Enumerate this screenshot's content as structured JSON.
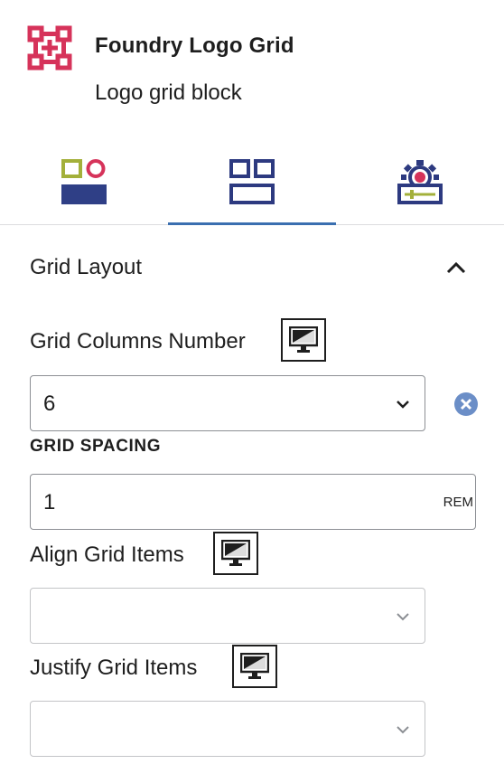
{
  "block": {
    "title": "Foundry Logo Grid",
    "description": "Logo grid block",
    "icon": "logo-grid-icon",
    "icon_color": "#d6335a"
  },
  "tabs": [
    {
      "name": "style",
      "icon": "shapes-style-icon",
      "active": false
    },
    {
      "name": "layout",
      "icon": "layout-blocks-icon",
      "active": true
    },
    {
      "name": "advanced",
      "icon": "gear-settings-icon",
      "active": false
    }
  ],
  "accent_color": "#3a6fb0",
  "panel": {
    "title": "Grid Layout",
    "expanded": true,
    "columns": {
      "label": "Grid Columns Number",
      "value": "6",
      "device_icon": "desktop-icon"
    },
    "spacing": {
      "label": "GRID SPACING",
      "value": "1",
      "unit": "REM"
    },
    "align": {
      "label": "Align Grid Items",
      "value": "",
      "device_icon": "desktop-icon"
    },
    "justify": {
      "label": "Justify Grid Items",
      "value": "",
      "device_icon": "desktop-icon"
    }
  }
}
